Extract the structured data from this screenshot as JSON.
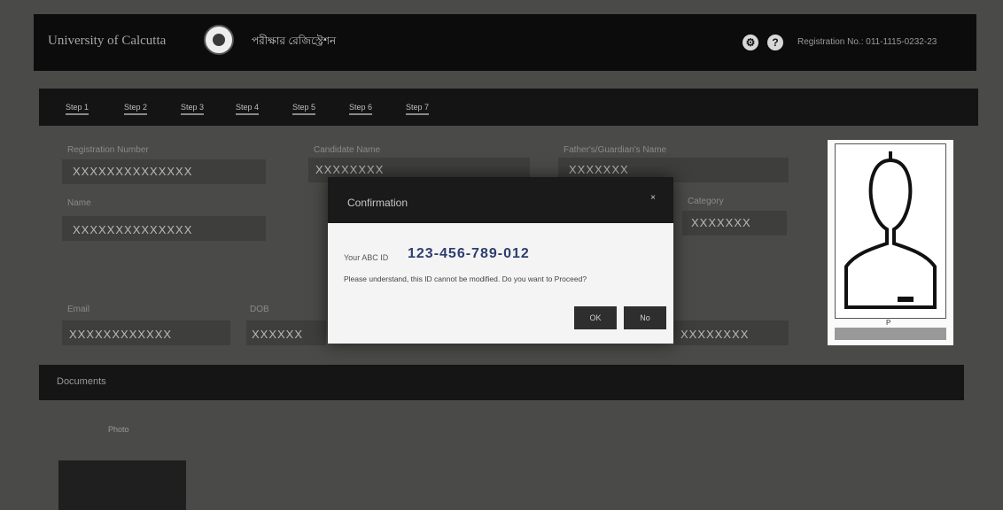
{
  "header": {
    "brand": "University of Calcutta",
    "exam_title": "পরীক্ষার রেজিস্ট্রেশন",
    "settings_icon": "gear-icon",
    "help_icon": "help-icon",
    "registration_no": "Registration No.: 011-1115-0232-23"
  },
  "steps": [
    "Step 1",
    "Step 2",
    "Step 3",
    "Step 4",
    "Step 5",
    "Step 6",
    "Step 7"
  ],
  "form": {
    "registration_label": "Registration Number",
    "registration_value": "XXXXXXXXXXXXXX",
    "candidate_label": "Candidate Name",
    "candidate_value": "XXXXXXXX",
    "guardian_label": "Father's/Guardian's Name",
    "guardian_value": "XXXXXXX",
    "name_label": "Name",
    "name_value": "XXXXXXXXXXXXXX",
    "category_label": "Category",
    "category_value": "XXXXXXX",
    "row3_label1": "Email",
    "row3_value1": "XXXXXXXXXXXX",
    "row3_label2": "DOB",
    "row3_value2": "XXXXXX",
    "row3_value3": "XXXXXXXX"
  },
  "photo": {
    "label": "P"
  },
  "documents": {
    "title": "Documents",
    "item_label": "Photo"
  },
  "modal": {
    "title": "Confirmation",
    "close_icon": "×",
    "id_label": "Your ABC ID",
    "id_value": "123-456-789-012",
    "warning": "Please understand, this ID cannot be modified. Do you want to Proceed?",
    "ok_label": "OK",
    "no_label": "No"
  }
}
